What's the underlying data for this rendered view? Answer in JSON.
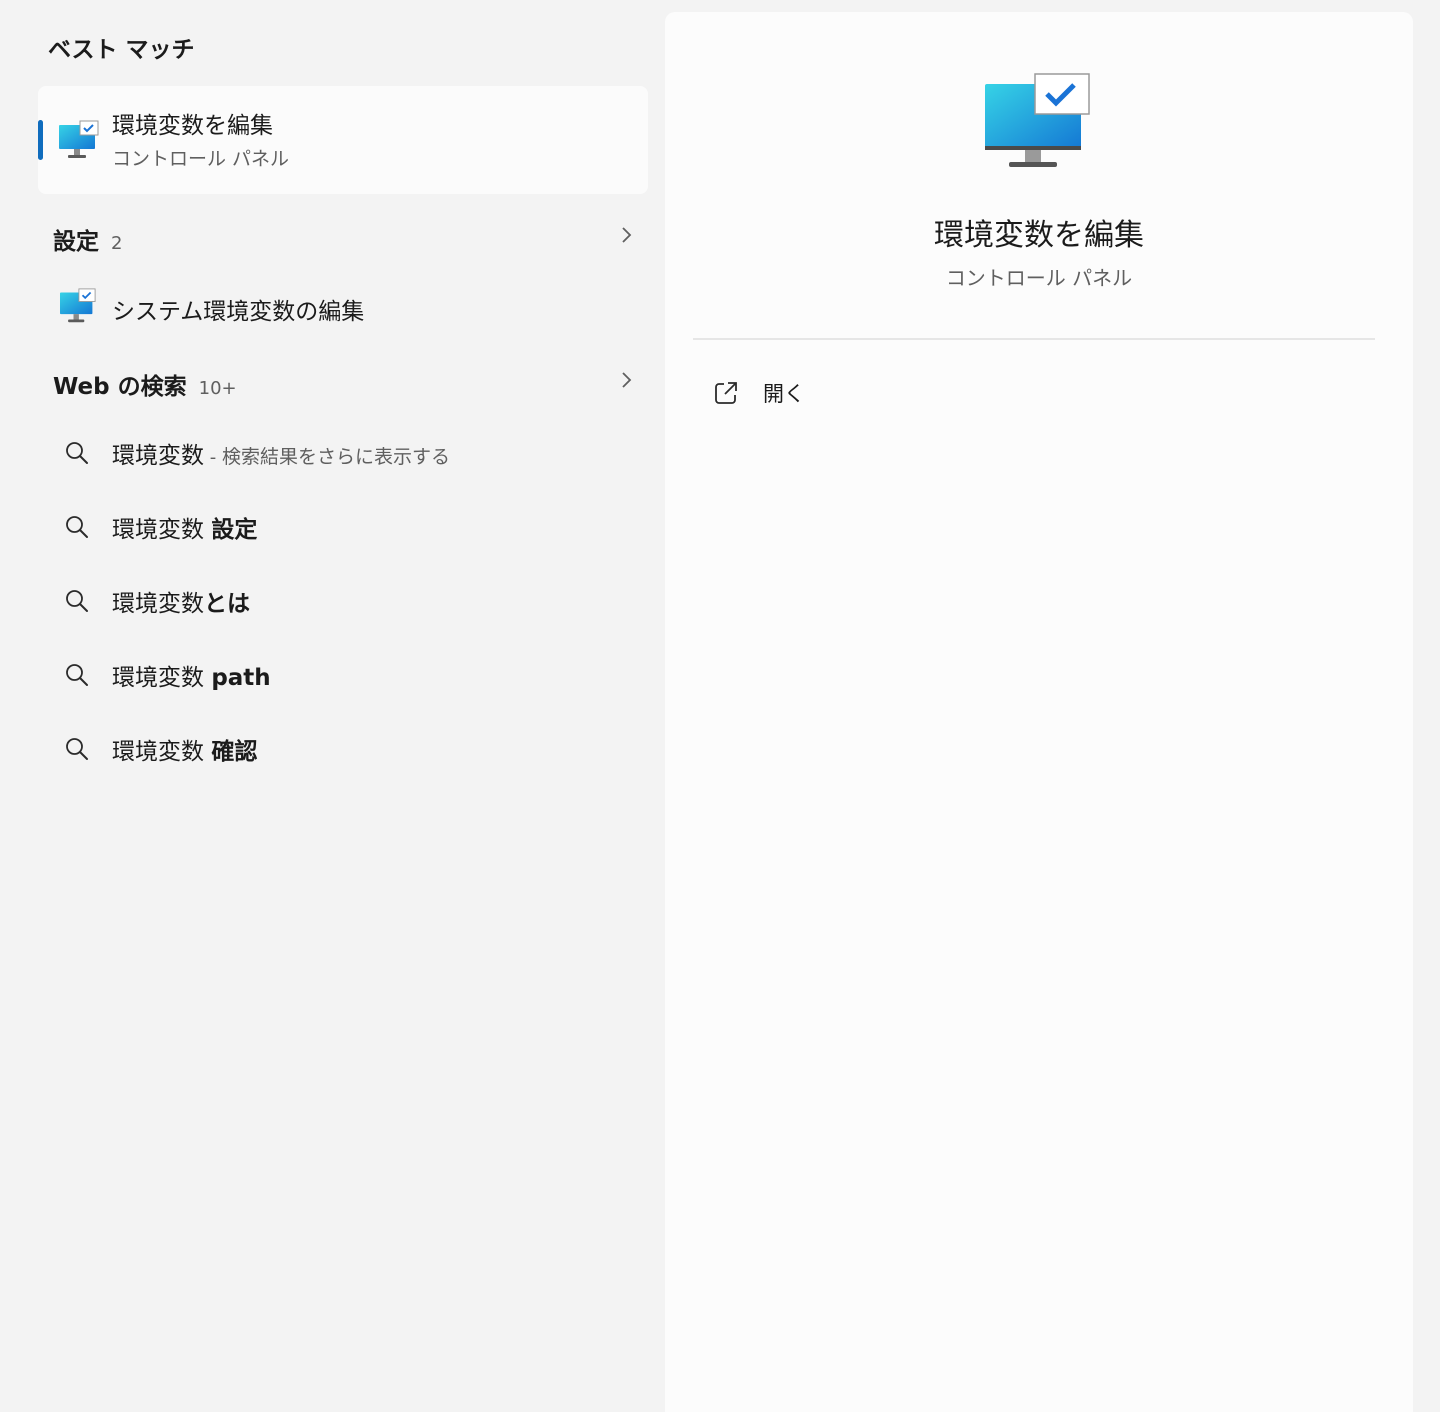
{
  "left": {
    "section_title": "ベスト マッチ",
    "best_match": {
      "title": "環境変数を編集",
      "subtitle": "コントロール パネル",
      "icon": "monitor-checkmark-icon"
    },
    "settings_group": {
      "label": "設定",
      "count": "2",
      "items": [
        {
          "label": "システム環境変数の編集",
          "icon": "monitor-checkmark-icon"
        }
      ]
    },
    "web_group": {
      "label": "Web の検索",
      "count": "10+",
      "items": [
        {
          "query": "環境変数",
          "separator": " - ",
          "hint": "検索結果をさらに表示する",
          "suffix": ""
        },
        {
          "query": "環境変数 ",
          "separator": "",
          "hint": "",
          "suffix": "設定"
        },
        {
          "query": "環境変数",
          "separator": "",
          "hint": "",
          "suffix": "とは"
        },
        {
          "query": "環境変数 ",
          "separator": "",
          "hint": "",
          "suffix": "path"
        },
        {
          "query": "環境変数 ",
          "separator": "",
          "hint": "",
          "suffix": "確認"
        }
      ]
    }
  },
  "preview": {
    "title": "環境変数を編集",
    "subtitle": "コントロール パネル",
    "icon": "monitor-checkmark-icon",
    "actions": [
      {
        "label": "開く",
        "icon": "open-external-icon"
      }
    ]
  },
  "colors": {
    "accent": "#0f6cbd",
    "background": "#f3f3f3",
    "panel": "#fcfcfc"
  }
}
